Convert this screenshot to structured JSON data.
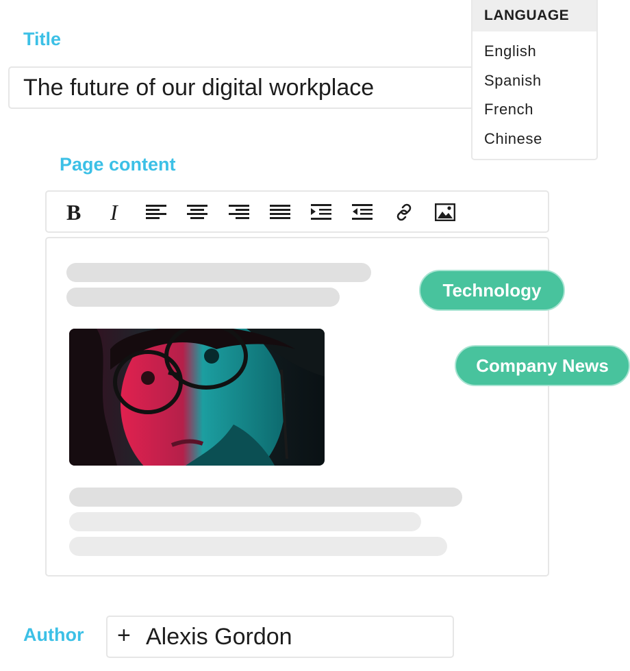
{
  "title_section": {
    "label": "Title",
    "value": "The future of our digital workplace"
  },
  "content_section": {
    "label": "Page content",
    "toolbar_icons": [
      "bold-icon",
      "italic-icon",
      "align-left-icon",
      "align-center-icon",
      "align-right-icon",
      "justify-icon",
      "indent-icon",
      "outdent-icon",
      "link-icon",
      "image-icon"
    ]
  },
  "editor": {
    "image": "portrait-photo"
  },
  "tags": {
    "technology": "Technology",
    "company_news": "Company News"
  },
  "language_menu": {
    "header": "LANGUAGE",
    "options": [
      "English",
      "Spanish",
      "French",
      "Chinese"
    ]
  },
  "author_section": {
    "label": "Author",
    "prefix": "+",
    "value": "Alexis Gordon"
  },
  "colors": {
    "label_accent": "#3cc0e6",
    "tag_green": "#48c39d",
    "skeleton": "#e0e0e0"
  }
}
